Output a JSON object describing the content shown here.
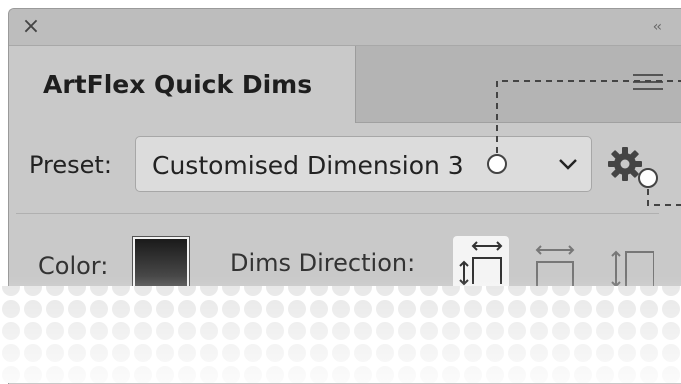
{
  "panel": {
    "close_glyph": "×",
    "collapse_glyph": "‹‹",
    "tab_title": "ArtFlex Quick Dims",
    "menu_icon": "hamburger-menu-icon"
  },
  "preset": {
    "label": "Preset:",
    "selected_value": "Customised Dimension 3",
    "dropdown_icon": "chevron-down-icon",
    "settings_icon": "gear-icon"
  },
  "options": {
    "color_label": "Color:",
    "swatch_color": "#333333",
    "dims_direction_label": "Dims Direction:",
    "directions": [
      {
        "name": "both-directions-icon",
        "selected": true
      },
      {
        "name": "horizontal-direction-icon",
        "selected": false
      },
      {
        "name": "vertical-direction-icon",
        "selected": false
      }
    ]
  },
  "colors": {
    "panel_bg": "#c9c9c9",
    "tab_bar_bg": "#b4b4b4",
    "selected_direction_bg": "#f4f4f4"
  }
}
